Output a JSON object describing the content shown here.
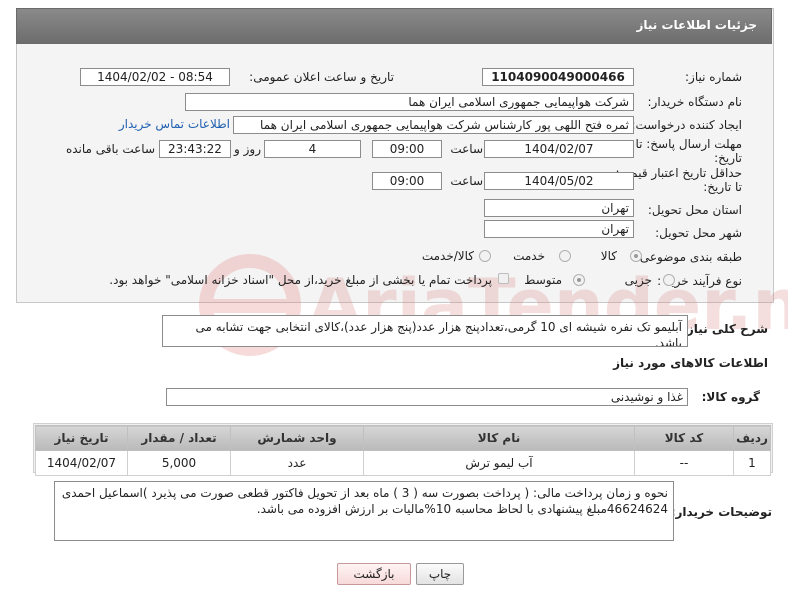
{
  "header": {
    "title": "جزئیات اطلاعات نیاز"
  },
  "labels": {
    "need_number": "شماره نیاز:",
    "announce_datetime": "تاریخ و ساعت اعلان عمومی:",
    "buyer_org": "نام دستگاه خریدار:",
    "requester": "ایجاد کننده درخواست:",
    "deadline_line1": "مهلت ارسال پاسخ: تا",
    "deadline_line2": "تاریخ:",
    "hour": "ساعت",
    "day_and": "روز و",
    "hours_left": "ساعت باقی مانده",
    "min_validity_line1": "حداقل تاریخ اعتبار قیمت:",
    "min_validity_line2": "تا تاریخ:",
    "hour2": "ساعت",
    "province": "استان محل تحویل:",
    "city": "شهر محل تحویل:",
    "category": "طبقه بندی موضوعی:",
    "purchase_type": "نوع فرآیند خرید :",
    "general_desc": "شرح کلی نیاز:",
    "goods_info": "اطلاعات کالاهای مورد نیاز",
    "goods_group": "گروه کالا:",
    "buyer_notes": "توضیحات خریدار:"
  },
  "values": {
    "need_number": "1104090049000466",
    "announce_datetime": "1404/02/02 - 08:54",
    "buyer_org": "شرکت هواپیمایی جمهوری اسلامی ایران هما",
    "requester": "ثمره فتح اللهی پور کارشناس شرکت هواپیمایی جمهوری اسلامی ایران هما",
    "contact_link": "اطلاعات تماس خریدار",
    "deadline_date": "1404/02/07",
    "deadline_time": "09:00",
    "days": "4",
    "remaining": "23:43:22",
    "validity_date": "1404/05/02",
    "validity_time": "09:00",
    "province": "تهران",
    "city": "تهران",
    "general_desc": "آبلیمو تک نفره شیشه ای 10 گرمی،تعدادپنج هزار عدد(پنج هزار عدد)،کالای انتخابی جهت تشابه می باشد.",
    "goods_group": "غذا و نوشیدنی",
    "buyer_notes": "نحوه و زمان پرداخت مالی:  ( پرداخت بصورت سه ( 3 ) ماه بعد از تحویل فاکتور قطعی  صورت می پذیرد )اسماعیل احمدی 46624624مبلغ پیشنهادی با لحاظ محاسبه 10%مالیات بر ارزش افزوده می باشد."
  },
  "category_options": {
    "goods": "کالا",
    "service": "خدمت",
    "goods_service": "کالا/خدمت"
  },
  "purchase_options": {
    "partial": "جزیی",
    "medium": "متوسط",
    "treasury_note": "پرداخت تمام یا بخشی از مبلغ خرید،از محل \"اسناد خزانه اسلامی\" خواهد بود."
  },
  "table": {
    "headers": [
      "ردیف",
      "کد کالا",
      "نام کالا",
      "واحد شمارش",
      "تعداد / مقدار",
      "تاریخ نیاز"
    ],
    "rows": [
      [
        "1",
        "--",
        "آب لیمو ترش",
        "عدد",
        "5,000",
        "1404/02/07"
      ]
    ]
  },
  "buttons": {
    "print": "چاپ",
    "back": "بازگشت"
  },
  "watermark": {
    "text": "AriaTender.neT"
  },
  "colors": {
    "header_bg": "#7a7a7a",
    "link": "#2060b0",
    "watermark": "#e89a9a"
  }
}
